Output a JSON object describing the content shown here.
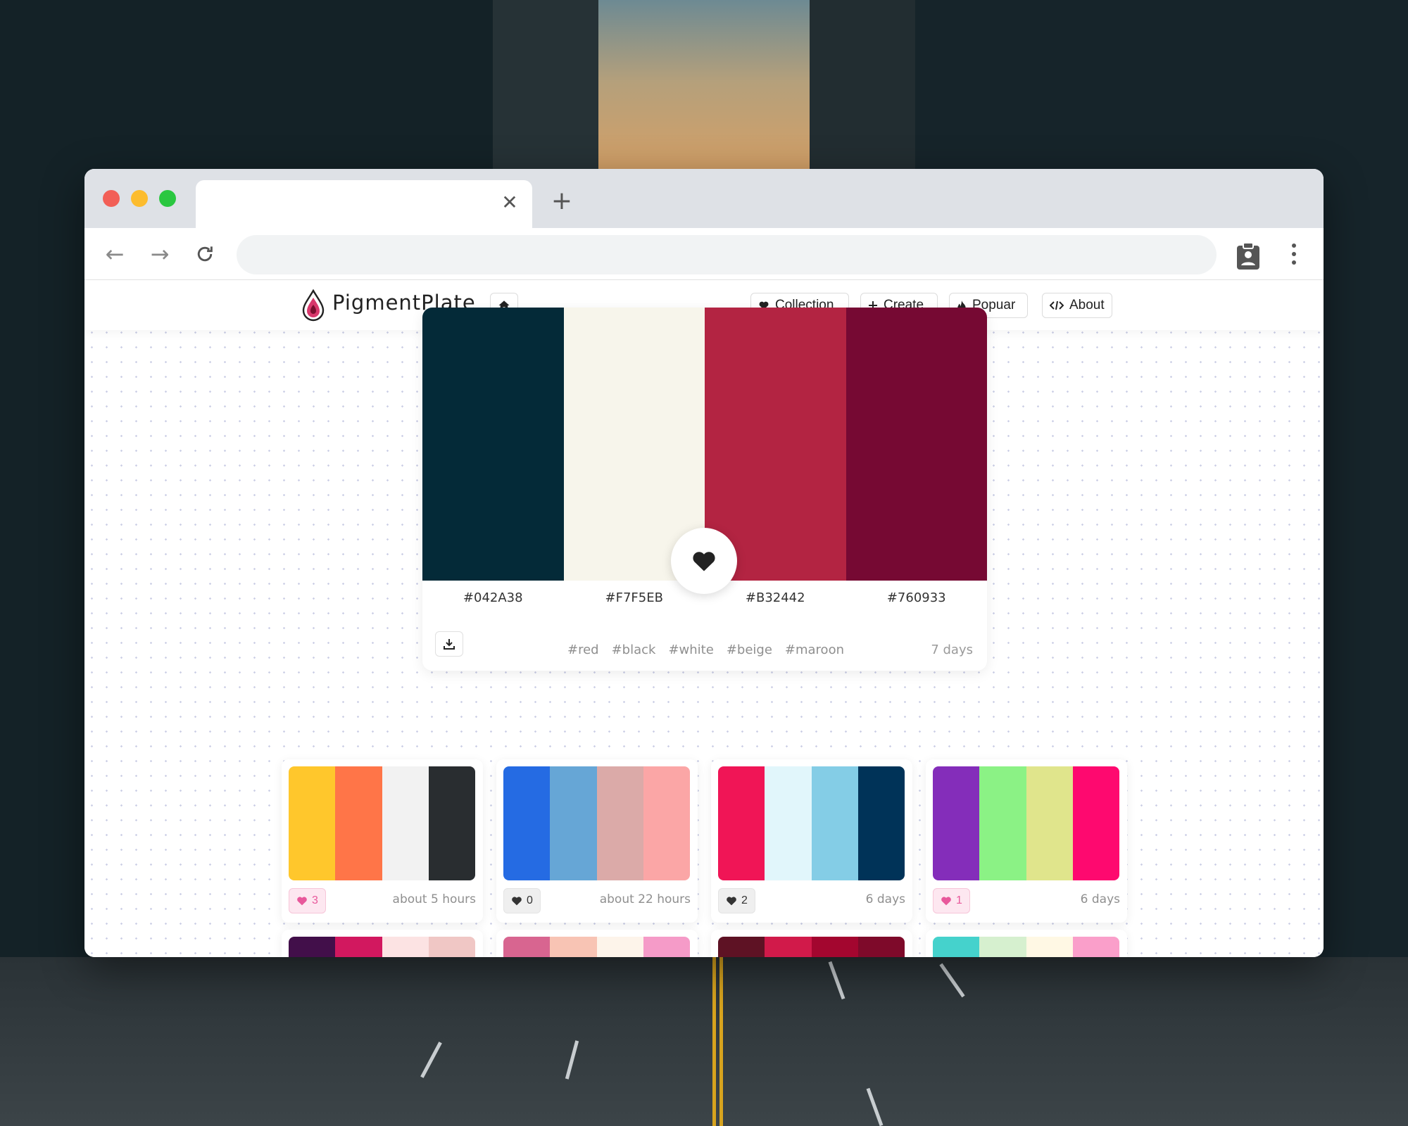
{
  "app": {
    "brand": "PigmentPlate",
    "nav": {
      "collection": "Collection",
      "create": "Create",
      "popular": "Popuar",
      "about": "About"
    }
  },
  "featured": {
    "colors": [
      "#042A38",
      "#F7F5EB",
      "#B32442",
      "#760933"
    ],
    "hex_labels": [
      "#042A38",
      "#F7F5EB",
      "#B32442",
      "#760933"
    ],
    "tags": [
      "#red",
      "#black",
      "#white",
      "#beige",
      "#maroon"
    ],
    "age": "7 days"
  },
  "palettes": [
    {
      "colors": [
        "#FFC72C",
        "#FF7548",
        "#F2F2F2",
        "#292D30"
      ],
      "likes": "3",
      "liked": true,
      "age": "about 5 hours"
    },
    {
      "colors": [
        "#256BE3",
        "#66A6D6",
        "#DBAAA8",
        "#FBA6A6"
      ],
      "likes": "0",
      "liked": false,
      "age": "about 22 hours"
    },
    {
      "colors": [
        "#F01556",
        "#E1F6FB",
        "#84CDE6",
        "#003358"
      ],
      "likes": "2",
      "liked": false,
      "age": "6 days"
    },
    {
      "colors": [
        "#842DBA",
        "#8BF285",
        "#E0E58C",
        "#FE096F"
      ],
      "likes": "1",
      "liked": true,
      "age": "6 days"
    }
  ],
  "palettes_row2": [
    {
      "colors": [
        "#420F4A",
        "#D2185F",
        "#FCE3E3",
        "#F0C7C5"
      ]
    },
    {
      "colors": [
        "#D86590",
        "#F8C4B4",
        "#FDF4EA",
        "#F59BC8"
      ]
    },
    {
      "colors": [
        "#5E1224",
        "#D11A4A",
        "#A3062F",
        "#7E0A2A"
      ]
    },
    {
      "colors": [
        "#45D2CC",
        "#D6F0CF",
        "#FFF8E4",
        "#FA9FCA"
      ]
    }
  ],
  "icons": {
    "heart": "heart-icon",
    "plus": "plus-icon",
    "fire": "fire-icon",
    "code": "code-icon",
    "home": "home-icon",
    "download": "download-icon"
  }
}
